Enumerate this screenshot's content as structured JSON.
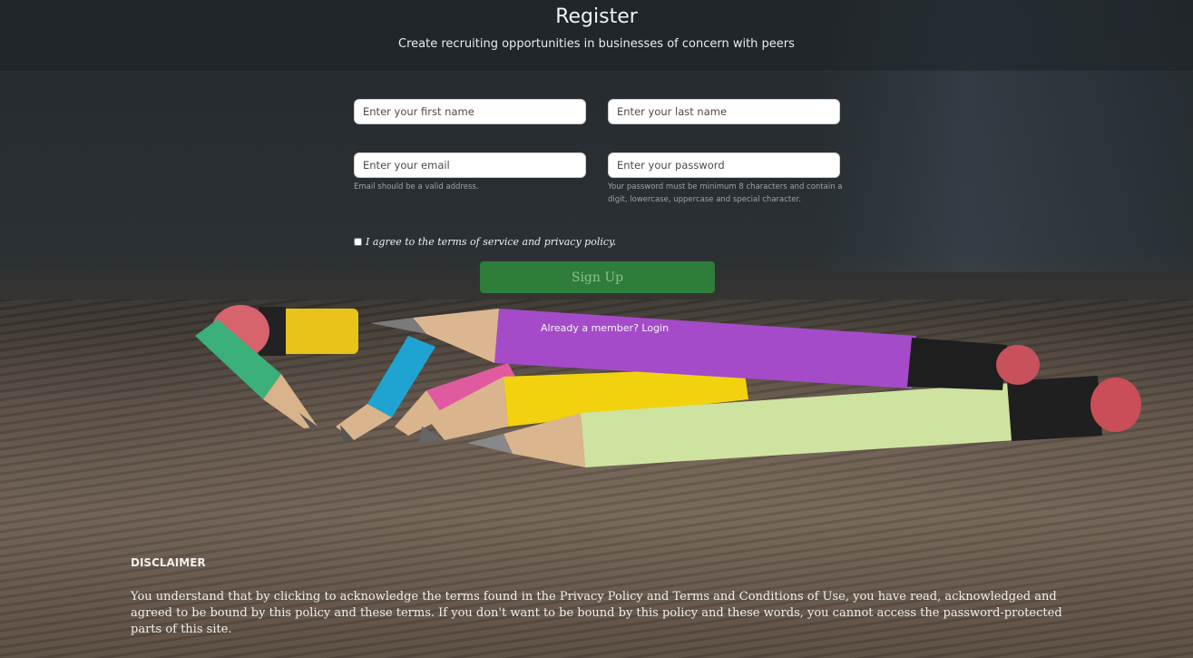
{
  "header": {
    "title": "Register",
    "subtitle": "Create recruiting opportunities in businesses of concern with peers"
  },
  "form": {
    "first_name_placeholder": "Enter your first name",
    "last_name_placeholder": "Enter your last name",
    "email_placeholder": "Enter your email",
    "password_placeholder": "Enter your password",
    "email_hint": "Email should be a valid address.",
    "password_hint_line1": "Your password must be minimum 8 characters and contain a",
    "password_hint_line2": "digit, lowercase, uppercase and special character.",
    "agree_label": "I agree to the terms of service and privacy policy.",
    "agree_checked": false,
    "signup_label": "Sign Up",
    "already_member_text": "Already a member? ",
    "login_label": "Login"
  },
  "disclaimer": {
    "title": "DISCLAIMER",
    "text": "You understand that by clicking to acknowledge the terms found in the Privacy Policy and Terms and Conditions of Use, you have read, acknowledged and agreed to be bound by this policy and these terms. If you don't want to be bound by this policy and these words, you cannot access the password-protected parts of this site."
  },
  "colors": {
    "signup_button": "#2e7d3a",
    "text_light": "#f0f0f0"
  },
  "icons": {
    "background": "pencils-on-wooden-table-photo"
  }
}
